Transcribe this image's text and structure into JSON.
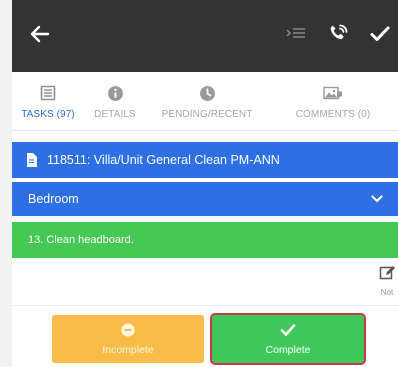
{
  "appbar": {
    "back_icon": "arrow-left-icon",
    "actions": [
      "indent-list-icon",
      "phone-call-icon",
      "check-icon"
    ]
  },
  "tabs": [
    {
      "label": "TASKS (97)",
      "icon": "list-icon",
      "active": true
    },
    {
      "label": "DETAILS",
      "icon": "info-icon",
      "active": false
    },
    {
      "label": "PENDING/RECENT",
      "icon": "clock-icon",
      "active": false
    },
    {
      "label": "COMMENTS (0)",
      "icon": "image-comment-icon",
      "active": false
    }
  ],
  "work_order": {
    "title": "118511: Villa/Unit General Clean PM-ANN",
    "icon": "document-icon"
  },
  "section": {
    "title": "Bedroom",
    "icon": "chevron-down-icon"
  },
  "task": {
    "title": "13. Clean headboard."
  },
  "notes": {
    "label": "Not",
    "icon": "edit-icon"
  },
  "buttons": {
    "incomplete_label": "Incomplete",
    "complete_label": "Complete"
  },
  "colors": {
    "appbar": "#333333",
    "accent_blue": "#2e6fe6",
    "task_green": "#45c853",
    "incomplete": "#f9bc48",
    "complete": "#3fc75a",
    "complete_outline": "#c53a45",
    "active_tab": "#2d6fd1"
  }
}
